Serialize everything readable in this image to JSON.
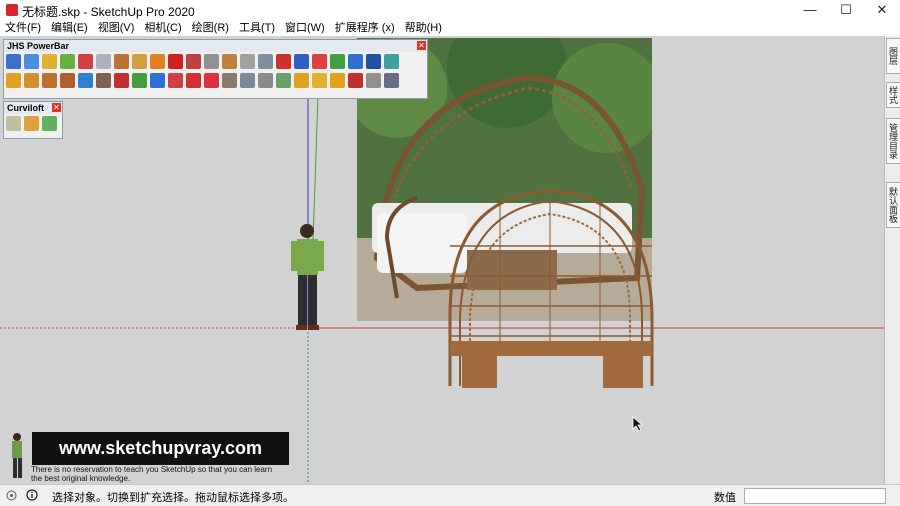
{
  "window": {
    "title": "无标题.skp - SketchUp Pro 2020"
  },
  "controls": {
    "minimize": "—",
    "maximize": "☐",
    "close": "✕"
  },
  "menu": [
    "文件(F)",
    "编辑(E)",
    "视图(V)",
    "相机(C)",
    "绘图(R)",
    "工具(T)",
    "窗口(W)",
    "扩展程序 (x)",
    "帮助(H)"
  ],
  "panels": {
    "powerbar_title": "JHS PowerBar",
    "curviloft_title": "Curviloft"
  },
  "tray_tabs": [
    "图层",
    "样式",
    "管理目录",
    "默认面板"
  ],
  "watermark": {
    "url": "www.sketchupvray.com",
    "line1": "There is no reservation to teach you SketchUp so that you can learn",
    "line2": "the best original knowledge."
  },
  "status": {
    "text": "选择对象。切换到扩充选择。拖动鼠标选择多项。",
    "measure_label": "数值"
  },
  "colors": {
    "accent_red": "#d9262c",
    "workspace": "#d2d2d2"
  }
}
